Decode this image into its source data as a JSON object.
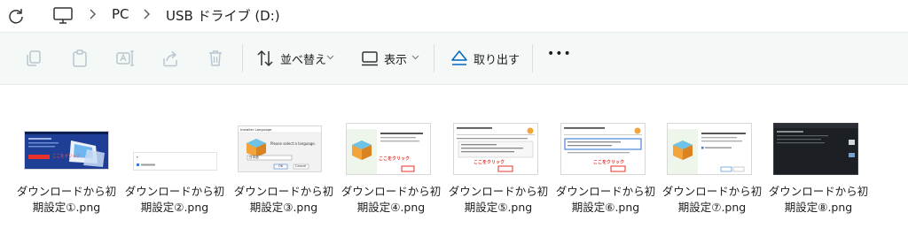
{
  "address_bar": {
    "breadcrumb": [
      "PC",
      "USB ドライブ (D:)"
    ]
  },
  "toolbar": {
    "sort_label": "並べ替え",
    "view_label": "表示",
    "eject_label": "取り出す",
    "more_label": "•••"
  },
  "thumbnail_text": {
    "click_here": "ここをクリック",
    "language_title": "Installer Language",
    "language_prompt": "Please select a language.",
    "language_value": "日本語",
    "ok": "OK",
    "cancel": "Cancel"
  },
  "files": [
    {
      "line1": "ダウンロードから初",
      "line2": "期設定①.png"
    },
    {
      "line1": "ダウンロードから初",
      "line2": "期設定②.png"
    },
    {
      "line1": "ダウンロードから初",
      "line2": "期設定③.png"
    },
    {
      "line1": "ダウンロードから初",
      "line2": "期設定④.png"
    },
    {
      "line1": "ダウンロードから初",
      "line2": "期設定⑤.png"
    },
    {
      "line1": "ダウンロードから初",
      "line2": "期設定⑥.png"
    },
    {
      "line1": "ダウンロードから初",
      "line2": "期設定⑦.png"
    },
    {
      "line1": "ダウンロードから初",
      "line2": "期設定⑧.png"
    }
  ],
  "colors": {
    "accent": "#0067c0",
    "toolbar_bg": "#f4f8f7",
    "click_red": "#e8302a"
  }
}
